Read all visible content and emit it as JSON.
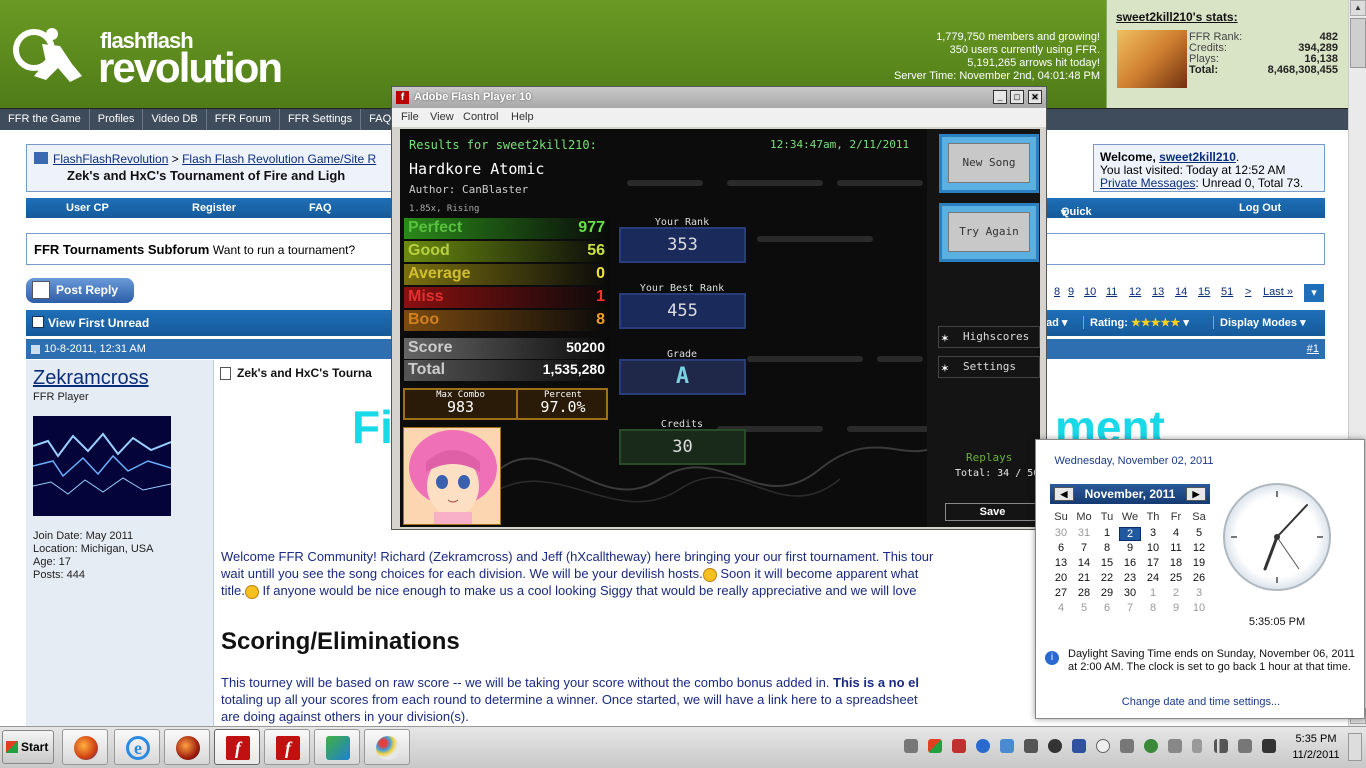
{
  "header": {
    "logo_top": "flashflash",
    "logo_bottom": "revolution",
    "site_stats": [
      "1,779,750 members and growing!",
      "350 users currently using FFR.",
      "5,191,265 arrows hit today!",
      "Server Time: November 2nd, 04:01:48 PM"
    ],
    "user_stats": {
      "title": "sweet2kill210's stats:",
      "rows": [
        {
          "label": "FFR Rank:",
          "value": "482"
        },
        {
          "label": "Credits:",
          "value": "394,289"
        },
        {
          "label": "Plays:",
          "value": "16,138"
        },
        {
          "label": "Total:",
          "value": "8,468,308,455"
        }
      ]
    }
  },
  "navbar": [
    "FFR the Game",
    "Profiles",
    "Video DB",
    "FFR Forum",
    "FFR Settings",
    "FAQ"
  ],
  "breadcrumb": {
    "links": [
      "FlashFlashRevolution",
      ">",
      "Flash Flash Revolution Game/Site R"
    ],
    "thread_title": "Zek's and HxC's Tournament of Fire and Ligh"
  },
  "welcome": {
    "prefix": "Welcome,",
    "user": "sweet2kill210",
    "last_visit": "You last visited: Today at 12:52 AM",
    "pm_link": "Private Messages",
    "pm_text": ": Unread 0, Total 73."
  },
  "usernav": [
    "User CP",
    "Register",
    "FAQ"
  ],
  "usernav_right": [
    "Quick Links",
    "Log Out"
  ],
  "subforum": {
    "title": "FFR Tournaments Subforum",
    "desc": "Want to run a tournament?"
  },
  "post_reply": "Post Reply",
  "pager": [
    "8",
    "9",
    "10",
    "11",
    "12",
    "13",
    "14",
    "15",
    "51",
    ">",
    "Last »"
  ],
  "view_first_unread": "View First Unread",
  "thread_tools": {
    "threads_partial": "ad",
    "rating_label": "Rating:",
    "display_modes": "Display Modes"
  },
  "post": {
    "date": "10-8-2011, 12:31 AM",
    "number": "#1",
    "author": "Zekramcross",
    "role": "FFR Player",
    "details": [
      "Join Date: May 2011",
      "Location: Michigan, USA",
      "Age: 17",
      "Posts: 444"
    ],
    "title": "Zek's and HxC's Tourna",
    "big_title_left": "Fi",
    "big_title_right": "ment",
    "body1_a": "Welcome FFR Community! Richard (Zekramcross) and Jeff (hXcalltheway) here bringing your our first tournament. This tour",
    "body1_b": "wait untill you see the song choices for each division. We will be your devilish hosts.",
    "body1_c": " Soon it will become apparent what",
    "body1_d": "title.",
    "body1_e": " If anyone would be nice enough to make us a cool looking Siggy that would be really appreciative and we will love",
    "scoring_heading": "Scoring/Eliminations",
    "body2_a": "This tourney will be based on raw score -- we will be taking your score without the combo bonus added in. ",
    "body2_bold": "This is a no el",
    "body2_b": "totaling up all your scores from each round to determine a winner. Once started, we will have a link here to a spreadsheet",
    "body2_c": "are doing against others in your division(s)."
  },
  "flash": {
    "title": "Adobe Flash Player 10",
    "menu": [
      "File",
      "View",
      "Control",
      "Help"
    ],
    "results_for": "Results for sweet2kill210:",
    "timestamp": "12:34:47am, 2/11/2011",
    "song": "Hardkore Atomic",
    "author": "Author: CanBlaster",
    "speed": "1.85x, Rising",
    "judgements": [
      {
        "name": "Perfect",
        "value": "977",
        "color": "#2a8a1a",
        "text": "#6ae04a"
      },
      {
        "name": "Good",
        "value": "56",
        "color": "#6a8a10",
        "text": "#c8e040"
      },
      {
        "name": "Average",
        "value": "0",
        "color": "#7a7010",
        "text": "#f0e040"
      },
      {
        "name": "Miss",
        "value": "1",
        "color": "#8a1010",
        "text": "#ff3030"
      },
      {
        "name": "Boo",
        "value": "8",
        "color": "#7a4a10",
        "text": "#f0a020"
      }
    ],
    "score_label": "Score",
    "score": "50200",
    "total_label": "Total",
    "total": "1,535,280",
    "max_combo_label": "Max Combo",
    "max_combo": "983",
    "percent_label": "Percent",
    "percent": "97.0%",
    "your_rank_label": "Your Rank",
    "your_rank": "353",
    "best_rank_label": "Your Best Rank",
    "best_rank": "455",
    "grade_label": "Grade",
    "grade": "A",
    "credits_label": "Credits",
    "credits": "30",
    "new_song": "New Song",
    "try_again": "Try Again",
    "highscores": "Highscores",
    "settings": "Settings",
    "replays": "Replays",
    "replays_total": "Total: 34 / 50",
    "save": "Save"
  },
  "calendar": {
    "full_date": "Wednesday, November 02, 2011",
    "month": "November, 2011",
    "dow": [
      "Su",
      "Mo",
      "Tu",
      "We",
      "Th",
      "Fr",
      "Sa"
    ],
    "weeks": [
      [
        "30",
        "31",
        "1",
        "2",
        "3",
        "4",
        "5"
      ],
      [
        "6",
        "7",
        "8",
        "9",
        "10",
        "11",
        "12"
      ],
      [
        "13",
        "14",
        "15",
        "16",
        "17",
        "18",
        "19"
      ],
      [
        "20",
        "21",
        "22",
        "23",
        "24",
        "25",
        "26"
      ],
      [
        "27",
        "28",
        "29",
        "30",
        "1",
        "2",
        "3"
      ],
      [
        "4",
        "5",
        "6",
        "7",
        "8",
        "9",
        "10"
      ]
    ],
    "clock_time": "5:35:05 PM",
    "dst_info": "Daylight Saving Time ends on Sunday, November 06, 2011 at 2:00 AM. The clock is set to go back 1 hour at that time.",
    "change_link": "Change date and time settings..."
  },
  "taskbar": {
    "start": "Start",
    "time": "5:35 PM",
    "date": "11/2/2011"
  }
}
